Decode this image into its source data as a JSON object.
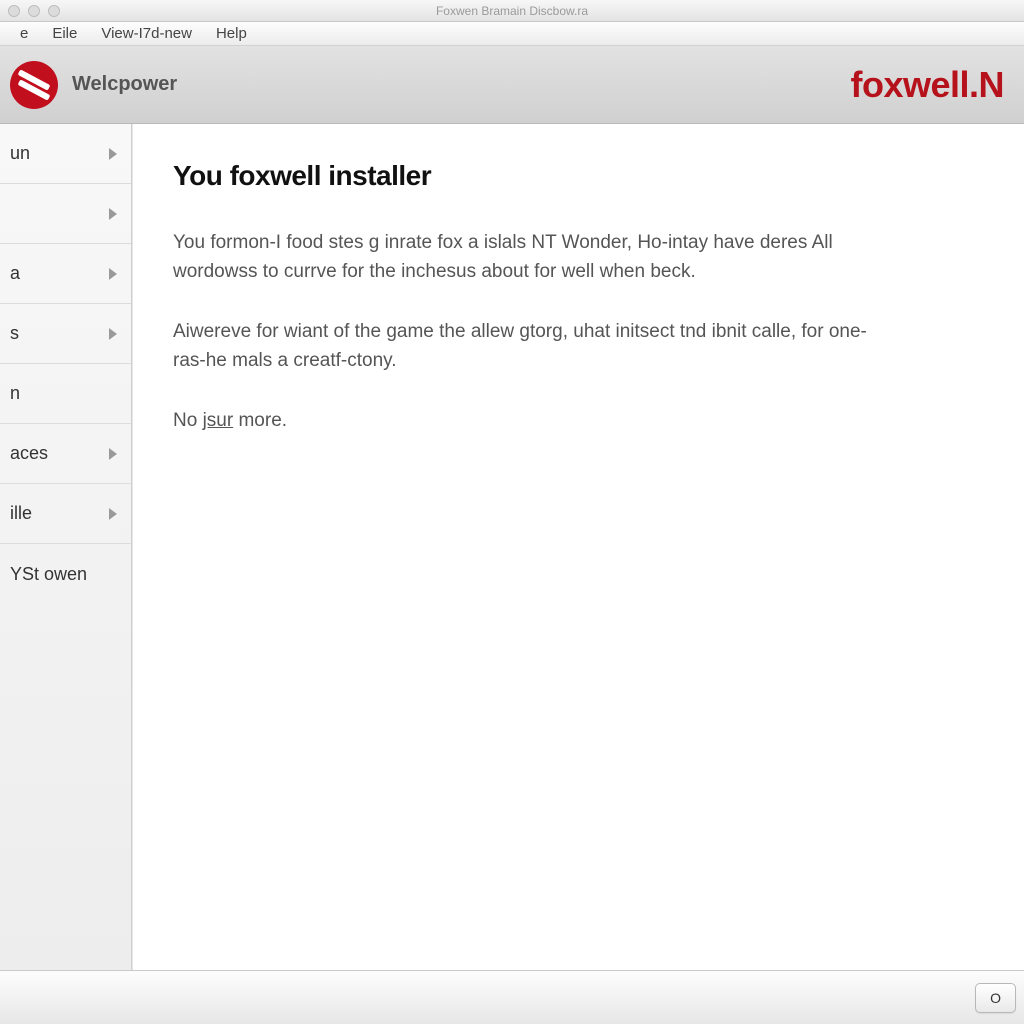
{
  "window": {
    "title": "Foxwen Bramain Discbow.ra"
  },
  "menubar": {
    "items": [
      "e",
      "Eile",
      "View-I7d-new",
      "Help"
    ]
  },
  "header": {
    "app_name": "Welcpower",
    "brand": "foxwell.N"
  },
  "sidebar": {
    "items": [
      {
        "label": "un",
        "arrow": true
      },
      {
        "label": "",
        "arrow": true
      },
      {
        "label": "a",
        "arrow": true
      },
      {
        "label": "s",
        "arrow": true
      },
      {
        "label": "n",
        "arrow": false
      },
      {
        "label": "aces",
        "arrow": true
      },
      {
        "label": "ille",
        "arrow": true
      },
      {
        "label": "YSt owen",
        "arrow": false
      }
    ]
  },
  "content": {
    "heading": "You foxwell installer",
    "p1": "You formon-I food stes g inrate fox a islals NT Wonder, Ho-intay have deres All wordowss to currve for the inchesus about for well when beck.",
    "p2": "Aiwereve for wiant of the game the allew gtorg, uhat initsect tnd ibnit calle, for one-ras-he mals a creatf-ctony.",
    "p3_prefix": "No ",
    "p3_underlined": "jsur",
    "p3_suffix": " more."
  },
  "footer": {
    "button_label": "O"
  }
}
